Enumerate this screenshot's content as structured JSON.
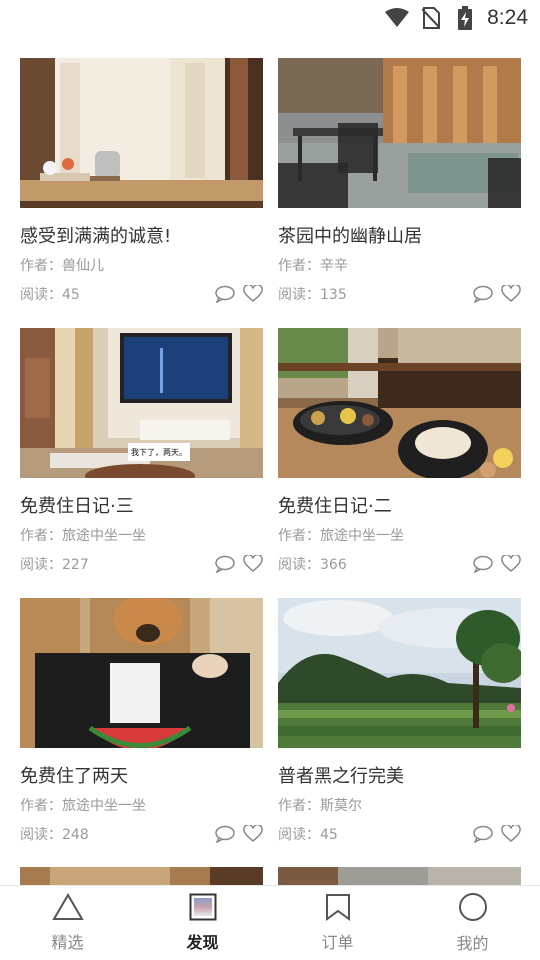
{
  "status_bar": {
    "time": "8:24"
  },
  "cards": [
    {
      "title": "感受到满满的诚意!",
      "author": "作者：兽仙儿",
      "reads": "阅读：45"
    },
    {
      "title": "茶园中的幽静山居",
      "author": "作者：辛辛",
      "reads": "阅读：135"
    },
    {
      "title": "免费住日记·三",
      "author": "作者：旅途中坐一坐",
      "reads": "阅读：227"
    },
    {
      "title": "免费住日记·二",
      "author": "作者：旅途中坐一坐",
      "reads": "阅读：366"
    },
    {
      "title": "免费住了两天",
      "author": "作者：旅途中坐一坐",
      "reads": "阅读：248"
    },
    {
      "title": "普者黑之行完美",
      "author": "作者：斯莫尔",
      "reads": "阅读：45"
    }
  ],
  "tabs": [
    {
      "label": "精选",
      "icon": "triangle-icon"
    },
    {
      "label": "发现",
      "icon": "square-icon"
    },
    {
      "label": "订单",
      "icon": "bookmark-icon"
    },
    {
      "label": "我的",
      "icon": "circle-icon"
    }
  ],
  "active_tab": "发现",
  "photo_caption": "我下了，两天。"
}
